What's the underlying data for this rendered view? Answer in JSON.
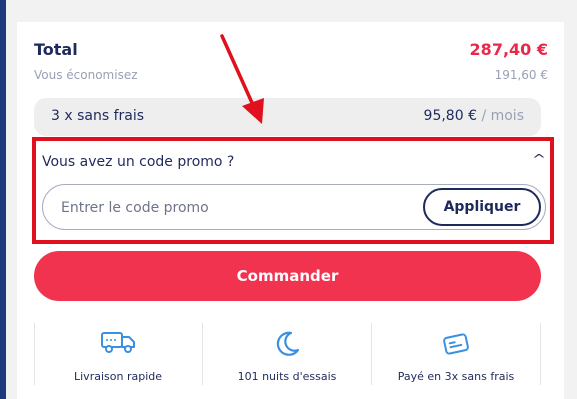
{
  "summary": {
    "total_label": "Total",
    "total_value": "287,40 €",
    "savings_label": "Vous économisez",
    "savings_value": "191,60 €"
  },
  "installments": {
    "label": "3 x sans frais",
    "amount": "95,80 €",
    "unit": "/ mois"
  },
  "promo": {
    "title": "Vous avez un code promo ?",
    "expanded": true,
    "placeholder": "Entrer le code promo",
    "apply_label": "Appliquer"
  },
  "order_button_label": "Commander",
  "features": [
    {
      "label": "Livraison rapide",
      "icon": "truck-icon"
    },
    {
      "label": "101 nuits d'essais",
      "icon": "moon-icon"
    },
    {
      "label": "Payé en 3x sans frais",
      "icon": "card-icon"
    }
  ],
  "colors": {
    "navy": "#1f2a5c",
    "accent_red": "#e8294a",
    "button_red": "#f2334f",
    "icon_blue": "#3b8fe0",
    "highlight_red": "#e0101e"
  }
}
